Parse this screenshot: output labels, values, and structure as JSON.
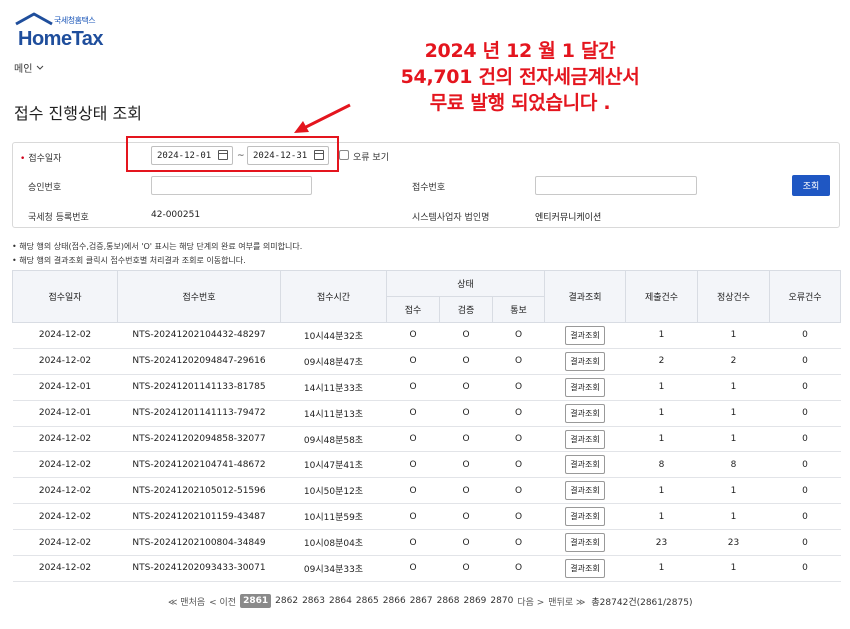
{
  "logo": {
    "sub": "국세청홈택스",
    "main": "HomeTax"
  },
  "menu": {
    "label": "메인",
    "icon": "chevron-down-icon"
  },
  "page": {
    "title": "접수 진행상태 조회"
  },
  "annotation": {
    "line1": "2024 년 12 월 1 달간",
    "line2": "54,701 건의  전자세금계산서",
    "line3": "무료  발행  되었습니다 .",
    "color": "#e4151e"
  },
  "search": {
    "date_label": "접수일자",
    "required_mark": "•",
    "date_from": "2024-12-01",
    "date_to": "2024-12-31",
    "tilde": "~",
    "error_only_label": "오류 보기",
    "approval_label": "승인번호",
    "approval_value": "",
    "receipt_label": "접수번호",
    "receipt_value": "",
    "nts_reg_label": "국세청 등록번호",
    "nts_reg_value": "42-000251",
    "sys_provider_label": "시스템사업자 법인명",
    "sys_provider_value": "엔티커뮤니케이션",
    "search_button": "조회",
    "accent_color": "#1f57c3"
  },
  "notes": [
    "해당 행의 상태(접수,검증,통보)에서 'O' 표시는 해당 단계의 완료 여부를 의미합니다.",
    "해당 행의 결과조회 클릭시 접수번호별 처리결과 조회로 이동합니다."
  ],
  "table": {
    "headers": {
      "date": "접수일자",
      "receipt_no": "접수번호",
      "time": "접수시간",
      "status": "상태",
      "s_receive": "접수",
      "s_verify": "검증",
      "s_notify": "통보",
      "result": "결과조회",
      "submitted": "제출건수",
      "normal": "정상건수",
      "error": "오류건수"
    },
    "rows": [
      {
        "date": "2024-12-02",
        "no": "NTS-20241202104432-48297",
        "time": "10시44분32초",
        "r": "O",
        "v": "O",
        "n": "O",
        "btn": "결과조회",
        "sub": "1",
        "ok": "1",
        "err": "0"
      },
      {
        "date": "2024-12-02",
        "no": "NTS-20241202094847-29616",
        "time": "09시48분47초",
        "r": "O",
        "v": "O",
        "n": "O",
        "btn": "결과조회",
        "sub": "2",
        "ok": "2",
        "err": "0"
      },
      {
        "date": "2024-12-01",
        "no": "NTS-20241201141133-81785",
        "time": "14시11분33초",
        "r": "O",
        "v": "O",
        "n": "O",
        "btn": "결과조회",
        "sub": "1",
        "ok": "1",
        "err": "0"
      },
      {
        "date": "2024-12-01",
        "no": "NTS-20241201141113-79472",
        "time": "14시11분13초",
        "r": "O",
        "v": "O",
        "n": "O",
        "btn": "결과조회",
        "sub": "1",
        "ok": "1",
        "err": "0"
      },
      {
        "date": "2024-12-02",
        "no": "NTS-20241202094858-32077",
        "time": "09시48분58초",
        "r": "O",
        "v": "O",
        "n": "O",
        "btn": "결과조회",
        "sub": "1",
        "ok": "1",
        "err": "0"
      },
      {
        "date": "2024-12-02",
        "no": "NTS-20241202104741-48672",
        "time": "10시47분41초",
        "r": "O",
        "v": "O",
        "n": "O",
        "btn": "결과조회",
        "sub": "8",
        "ok": "8",
        "err": "0"
      },
      {
        "date": "2024-12-02",
        "no": "NTS-20241202105012-51596",
        "time": "10시50분12초",
        "r": "O",
        "v": "O",
        "n": "O",
        "btn": "결과조회",
        "sub": "1",
        "ok": "1",
        "err": "0"
      },
      {
        "date": "2024-12-02",
        "no": "NTS-20241202101159-43487",
        "time": "10시11분59초",
        "r": "O",
        "v": "O",
        "n": "O",
        "btn": "결과조회",
        "sub": "1",
        "ok": "1",
        "err": "0"
      },
      {
        "date": "2024-12-02",
        "no": "NTS-20241202100804-34849",
        "time": "10시08분04초",
        "r": "O",
        "v": "O",
        "n": "O",
        "btn": "결과조회",
        "sub": "23",
        "ok": "23",
        "err": "0"
      },
      {
        "date": "2024-12-02",
        "no": "NTS-20241202093433-30071",
        "time": "09시34분33초",
        "r": "O",
        "v": "O",
        "n": "O",
        "btn": "결과조회",
        "sub": "1",
        "ok": "1",
        "err": "0"
      }
    ]
  },
  "pager": {
    "first": "≪ 맨처음",
    "prev": "< 이전",
    "current": "2861",
    "pages": [
      "2862",
      "2863",
      "2864",
      "2865",
      "2866",
      "2867",
      "2868",
      "2869",
      "2870"
    ],
    "next": "다음 >",
    "last": "맨뒤로 ≫",
    "total": "총28742건(2861/2875)"
  }
}
